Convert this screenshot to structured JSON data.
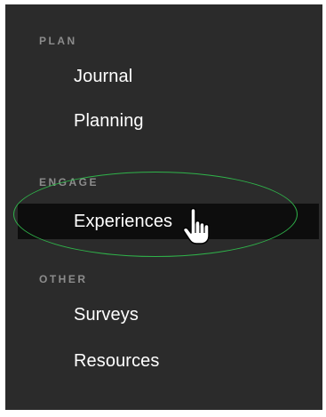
{
  "sidebar": {
    "sections": [
      {
        "heading": "PLAN",
        "items": [
          {
            "label": "Journal"
          },
          {
            "label": "Planning"
          }
        ]
      },
      {
        "heading": "ENGAGE",
        "items": [
          {
            "label": "Experiences",
            "active": true
          }
        ]
      },
      {
        "heading": "OTHER",
        "items": [
          {
            "label": "Surveys"
          },
          {
            "label": "Resources"
          }
        ]
      }
    ]
  },
  "annotation": {
    "highlight_color": "#2fb34a",
    "cursor_icon": "hand-pointer-icon"
  },
  "colors": {
    "sidebar_bg": "#2b2b2b",
    "active_bg": "#0d0d0d",
    "heading": "#8c8c8c",
    "item_text": "#ffffff"
  }
}
